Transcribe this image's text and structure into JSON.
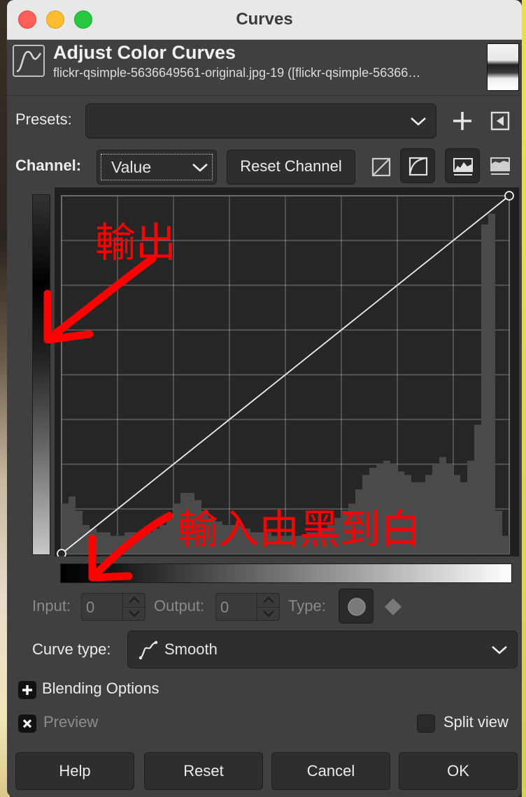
{
  "window": {
    "title": "Curves"
  },
  "header": {
    "title": "Adjust Color Curves",
    "subtitle": "flickr-qsimple-5636649561-original.jpg-19 ([flickr-qsimple-56366…"
  },
  "presets": {
    "label": "Presets:",
    "value": ""
  },
  "channel": {
    "label": "Channel:",
    "value": "Value",
    "reset_label": "Reset Channel"
  },
  "point": {
    "input_label": "Input:",
    "input_value": "0",
    "output_label": "Output:",
    "output_value": "0",
    "type_label": "Type:"
  },
  "curve_type": {
    "label": "Curve type:",
    "value": "Smooth"
  },
  "blending": {
    "label": "Blending Options"
  },
  "preview": {
    "label": "Preview",
    "checked": true
  },
  "split_view": {
    "label": "Split view",
    "checked": false
  },
  "buttons": {
    "help": "Help",
    "reset": "Reset",
    "cancel": "Cancel",
    "ok": "OK"
  },
  "annotations": {
    "output": "輸出",
    "input": "輸入由黑到白",
    "color": "#ff0000"
  },
  "curve": {
    "points": [
      [
        0,
        0
      ],
      [
        255,
        255
      ]
    ]
  },
  "histogram": [
    0.14,
    0.16,
    0.12,
    0.08,
    0.07,
    0.06,
    0.06,
    0.05,
    0.05,
    0.06,
    0.06,
    0.05,
    0.06,
    0.07,
    0.08,
    0.1,
    0.14,
    0.17,
    0.17,
    0.15,
    0.12,
    0.1,
    0.09,
    0.08,
    0.08,
    0.08,
    0.07,
    0.06,
    0.06,
    0.06,
    0.05,
    0.05,
    0.05,
    0.05,
    0.05,
    0.06,
    0.06,
    0.07,
    0.08,
    0.1,
    0.12,
    0.14,
    0.18,
    0.22,
    0.24,
    0.25,
    0.26,
    0.25,
    0.23,
    0.22,
    0.2,
    0.2,
    0.22,
    0.25,
    0.27,
    0.25,
    0.22,
    0.2,
    0.26,
    0.36,
    0.92,
    0.95,
    0.12,
    0.05
  ]
}
